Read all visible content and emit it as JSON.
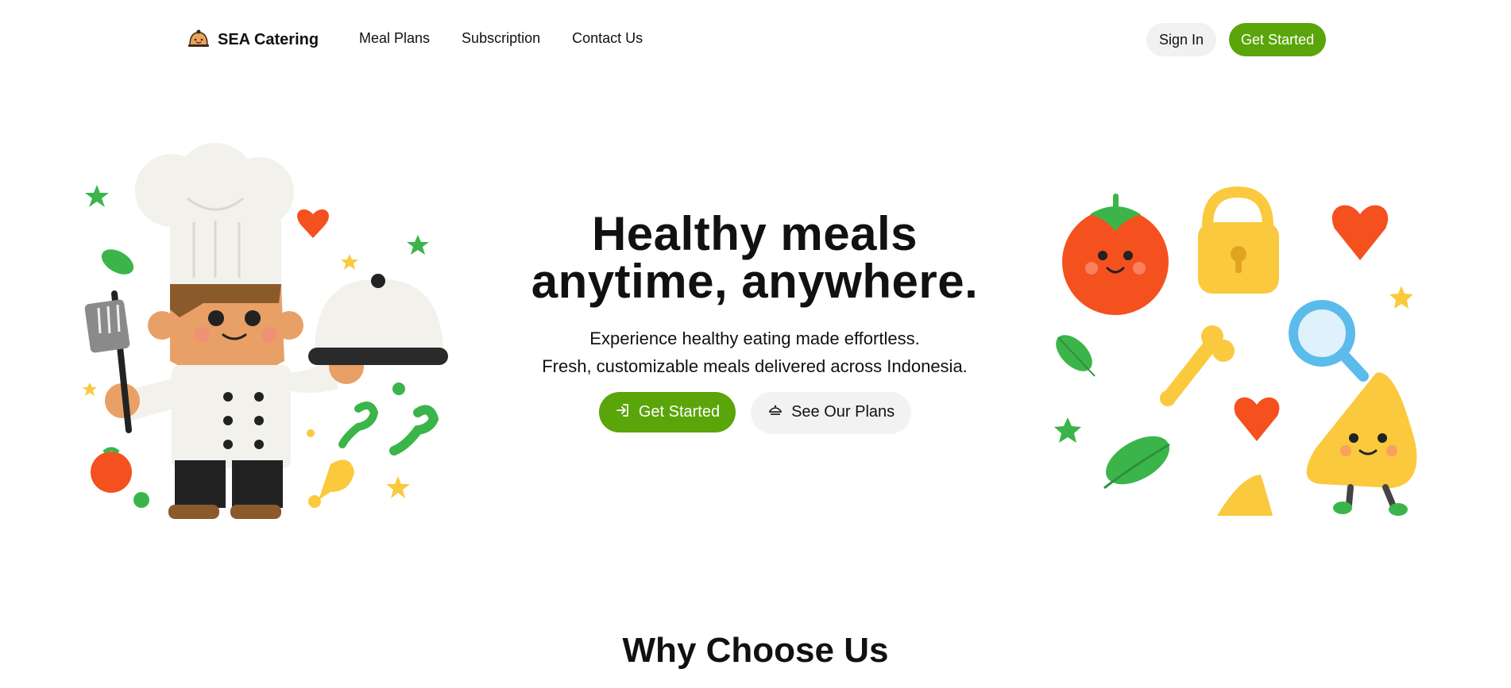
{
  "nav": {
    "brand": "SEA Catering",
    "brand_icon": "chef-hat-icon",
    "links": [
      "Meal Plans",
      "Subscription",
      "Contact Us"
    ],
    "sign_in": "Sign In",
    "get_started": "Get Started"
  },
  "hero": {
    "title_line1": "Healthy meals",
    "title_line2": "anytime, anywhere.",
    "subtitle_line1": "Experience healthy eating made effortless.",
    "subtitle_line2": "Fresh, customizable meals delivered across Indonesia.",
    "primary_button": "Get Started",
    "primary_icon": "sign-in-icon",
    "secondary_button": "See Our Plans",
    "secondary_icon": "food-dish-icon"
  },
  "features": {
    "title": "Why Choose Us"
  },
  "colors": {
    "accent": "#5aa50a",
    "tomato": "#f4511e",
    "leaf": "#3bb54a",
    "yellow": "#fbc93d"
  }
}
